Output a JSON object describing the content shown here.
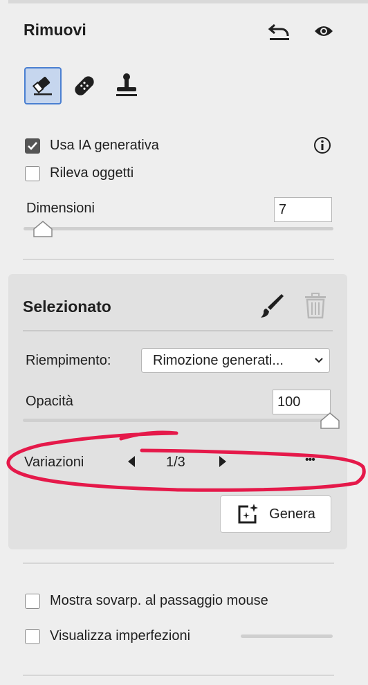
{
  "header": {
    "title": "Rimuovi"
  },
  "icons": {
    "undo": "undo-icon",
    "eye": "eye-icon",
    "eraser": "eraser-icon",
    "bandage": "bandage-icon",
    "stamp": "stamp-icon",
    "info": "info-icon",
    "brush": "brush-icon",
    "trash": "trash-icon",
    "generate": "generate-icon"
  },
  "options": {
    "generative_ai": {
      "label": "Usa IA generativa",
      "checked": true
    },
    "detect_objects": {
      "label": "Rileva oggetti",
      "checked": false
    }
  },
  "size": {
    "label": "Dimensioni",
    "value": "7",
    "level": 0.07
  },
  "selected": {
    "title": "Selezionato",
    "fill_label": "Riempimento:",
    "fill_value": "Rimozione generati...",
    "opacity_label": "Opacità",
    "opacity_value": "100",
    "opacity_level": 1.0,
    "variations_label": "Variazioni",
    "variations_counter": "1/3",
    "more": "•••",
    "generate_label": "Genera"
  },
  "bottom": {
    "show_overlay": {
      "label": "Mostra sovarp. al passaggio mouse",
      "checked": false
    },
    "show_flaws": {
      "label": "Visualizza imperfezioni",
      "checked": false
    }
  },
  "colors": {
    "accent": "#4a7fd1",
    "annotation": "#e5194a",
    "panel": "#e1e1e1"
  }
}
